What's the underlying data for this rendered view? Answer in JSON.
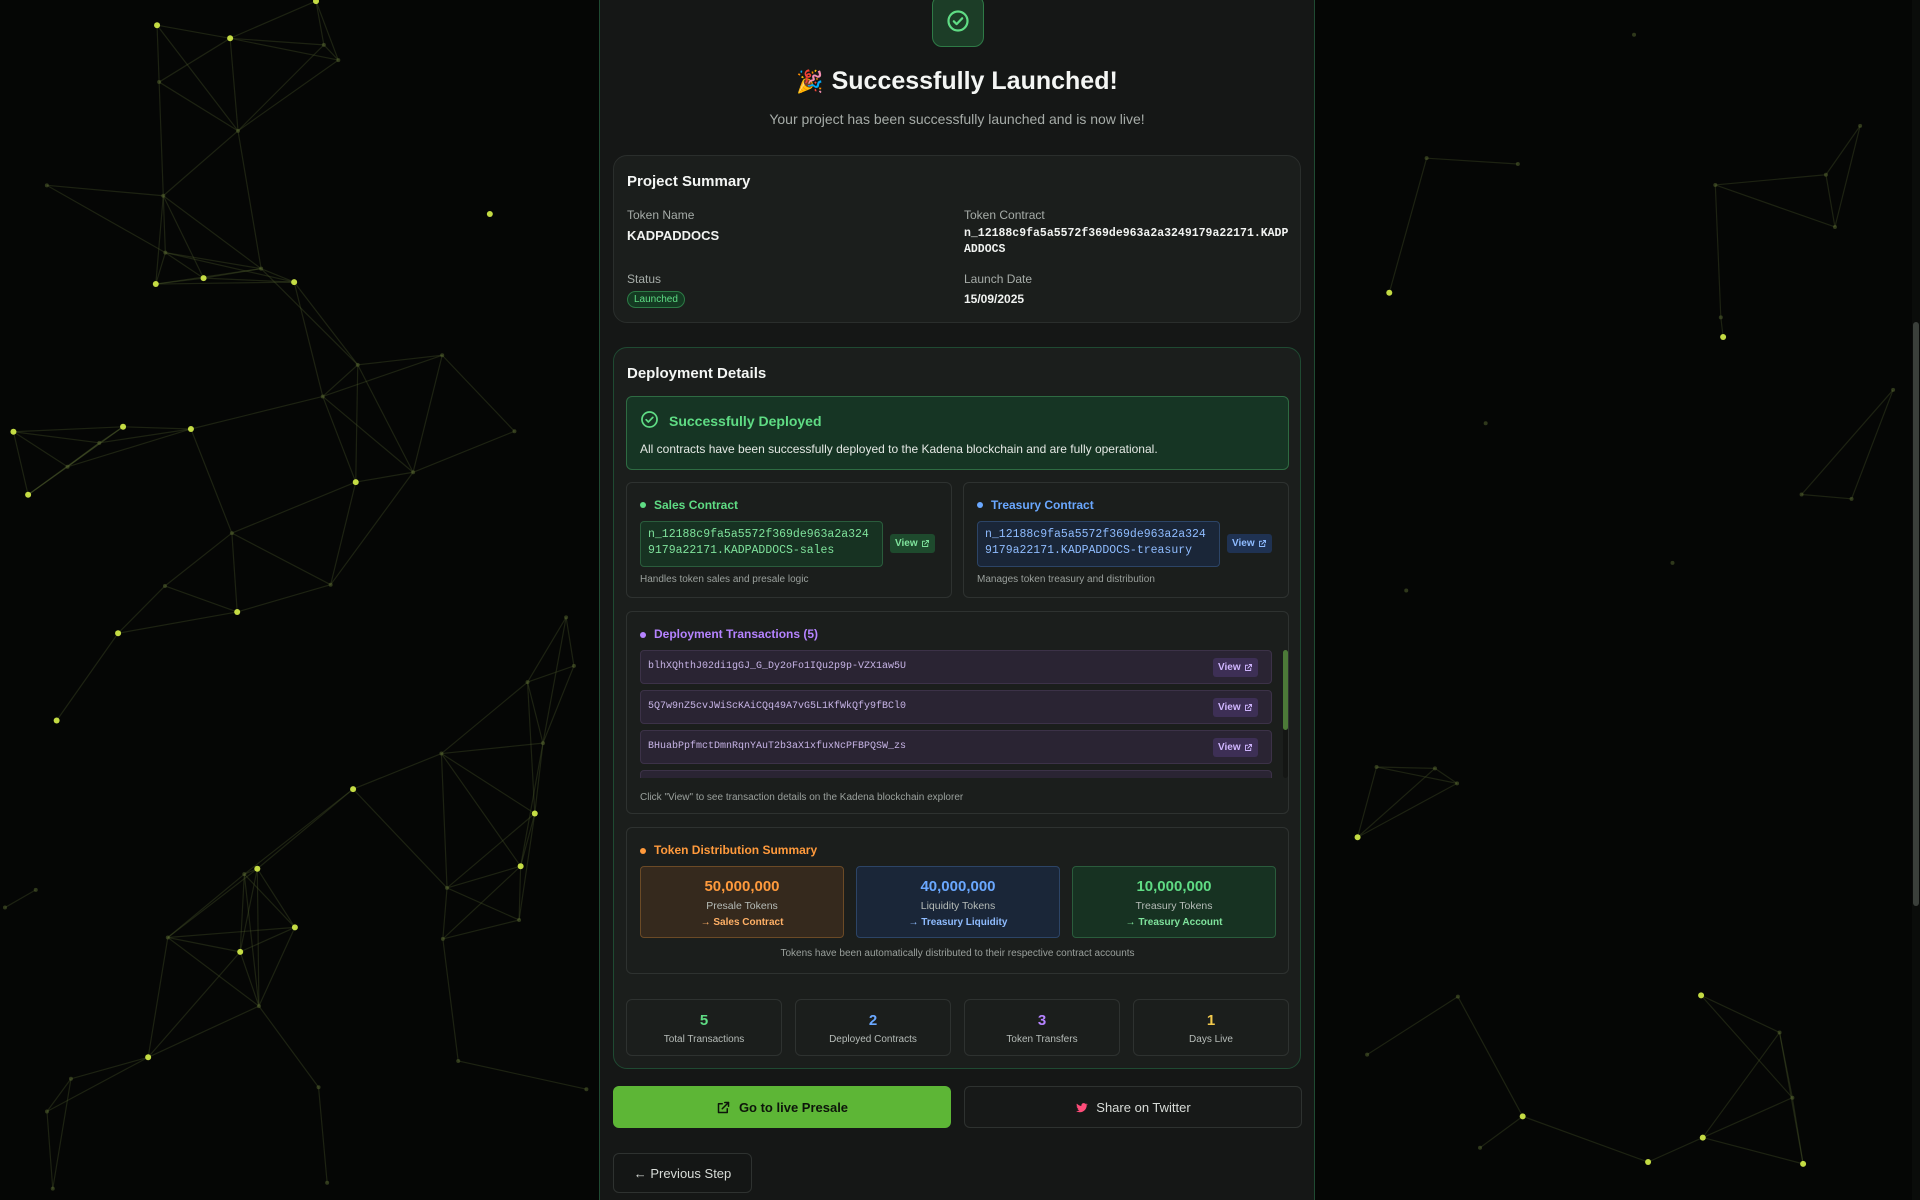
{
  "hero": {
    "title": "Successfully Launched!",
    "subtitle": "Your project has been successfully launched and is now live!",
    "icon": "check-circle-icon",
    "emoji": "🎉"
  },
  "summary": {
    "title": "Project Summary",
    "token_name_label": "Token Name",
    "token_name": "KADPADDOCS",
    "token_contract_label": "Token Contract",
    "token_contract": "n_12188c9fa5a5572f369de963a2a3249179a22171.KADPADDOCS",
    "status_label": "Status",
    "status": "Launched",
    "launch_date_label": "Launch Date",
    "launch_date": "15/09/2025"
  },
  "deployment": {
    "title": "Deployment Details",
    "success_title": "Successfully Deployed",
    "success_text": "All contracts have been successfully deployed to the Kadena blockchain and are fully operational.",
    "sales": {
      "title": "Sales Contract",
      "address": "n_12188c9fa5a5572f369de963a2a3249179a22171.KADPADDOCS-sales",
      "view": "View",
      "note": "Handles token sales and presale logic"
    },
    "treasury": {
      "title": "Treasury Contract",
      "address": "n_12188c9fa5a5572f369de963a2a3249179a22171.KADPADDOCS-treasury",
      "view": "View",
      "note": "Manages token treasury and distribution"
    },
    "transactions": {
      "title": "Deployment Transactions (5)",
      "items": [
        {
          "hash": "blhXQhthJ02di1gGJ_G_Dy2oFo1IQu2p9p-VZX1aw5U",
          "view": "View"
        },
        {
          "hash": "5Q7w9nZ5cvJWiScKAiCQq49A7vG5L1KfWkQfy9fBCl0",
          "view": "View"
        },
        {
          "hash": "BHuabPpfmctDmnRqnYAuT2b3aX1xfuxNcPFBPQSW_zs",
          "view": "View"
        }
      ],
      "note": "Click \"View\" to see transaction details on the Kadena blockchain explorer"
    },
    "distribution": {
      "title": "Token Distribution Summary",
      "items": [
        {
          "amount": "50,000,000",
          "label": "Presale Tokens",
          "dest": "→ Sales Contract"
        },
        {
          "amount": "40,000,000",
          "label": "Liquidity Tokens",
          "dest": "→ Treasury Liquidity"
        },
        {
          "amount": "10,000,000",
          "label": "Treasury Tokens",
          "dest": "→ Treasury Account"
        }
      ],
      "note": "Tokens have been automatically distributed to their respective contract accounts"
    },
    "stats": [
      {
        "value": "5",
        "label": "Total Transactions"
      },
      {
        "value": "2",
        "label": "Deployed Contracts"
      },
      {
        "value": "3",
        "label": "Token Transfers"
      },
      {
        "value": "1",
        "label": "Days Live"
      }
    ]
  },
  "actions": {
    "go_live": "Go to live Presale",
    "share": "Share on Twitter",
    "previous": "← Previous Step"
  },
  "colors": {
    "accent": "#5db636",
    "success": "#5fdc84",
    "sales": "#5fdc84",
    "treasury": "#6aa8ff",
    "transactions": "#b583ff",
    "distribution": "#ff9a3c"
  }
}
